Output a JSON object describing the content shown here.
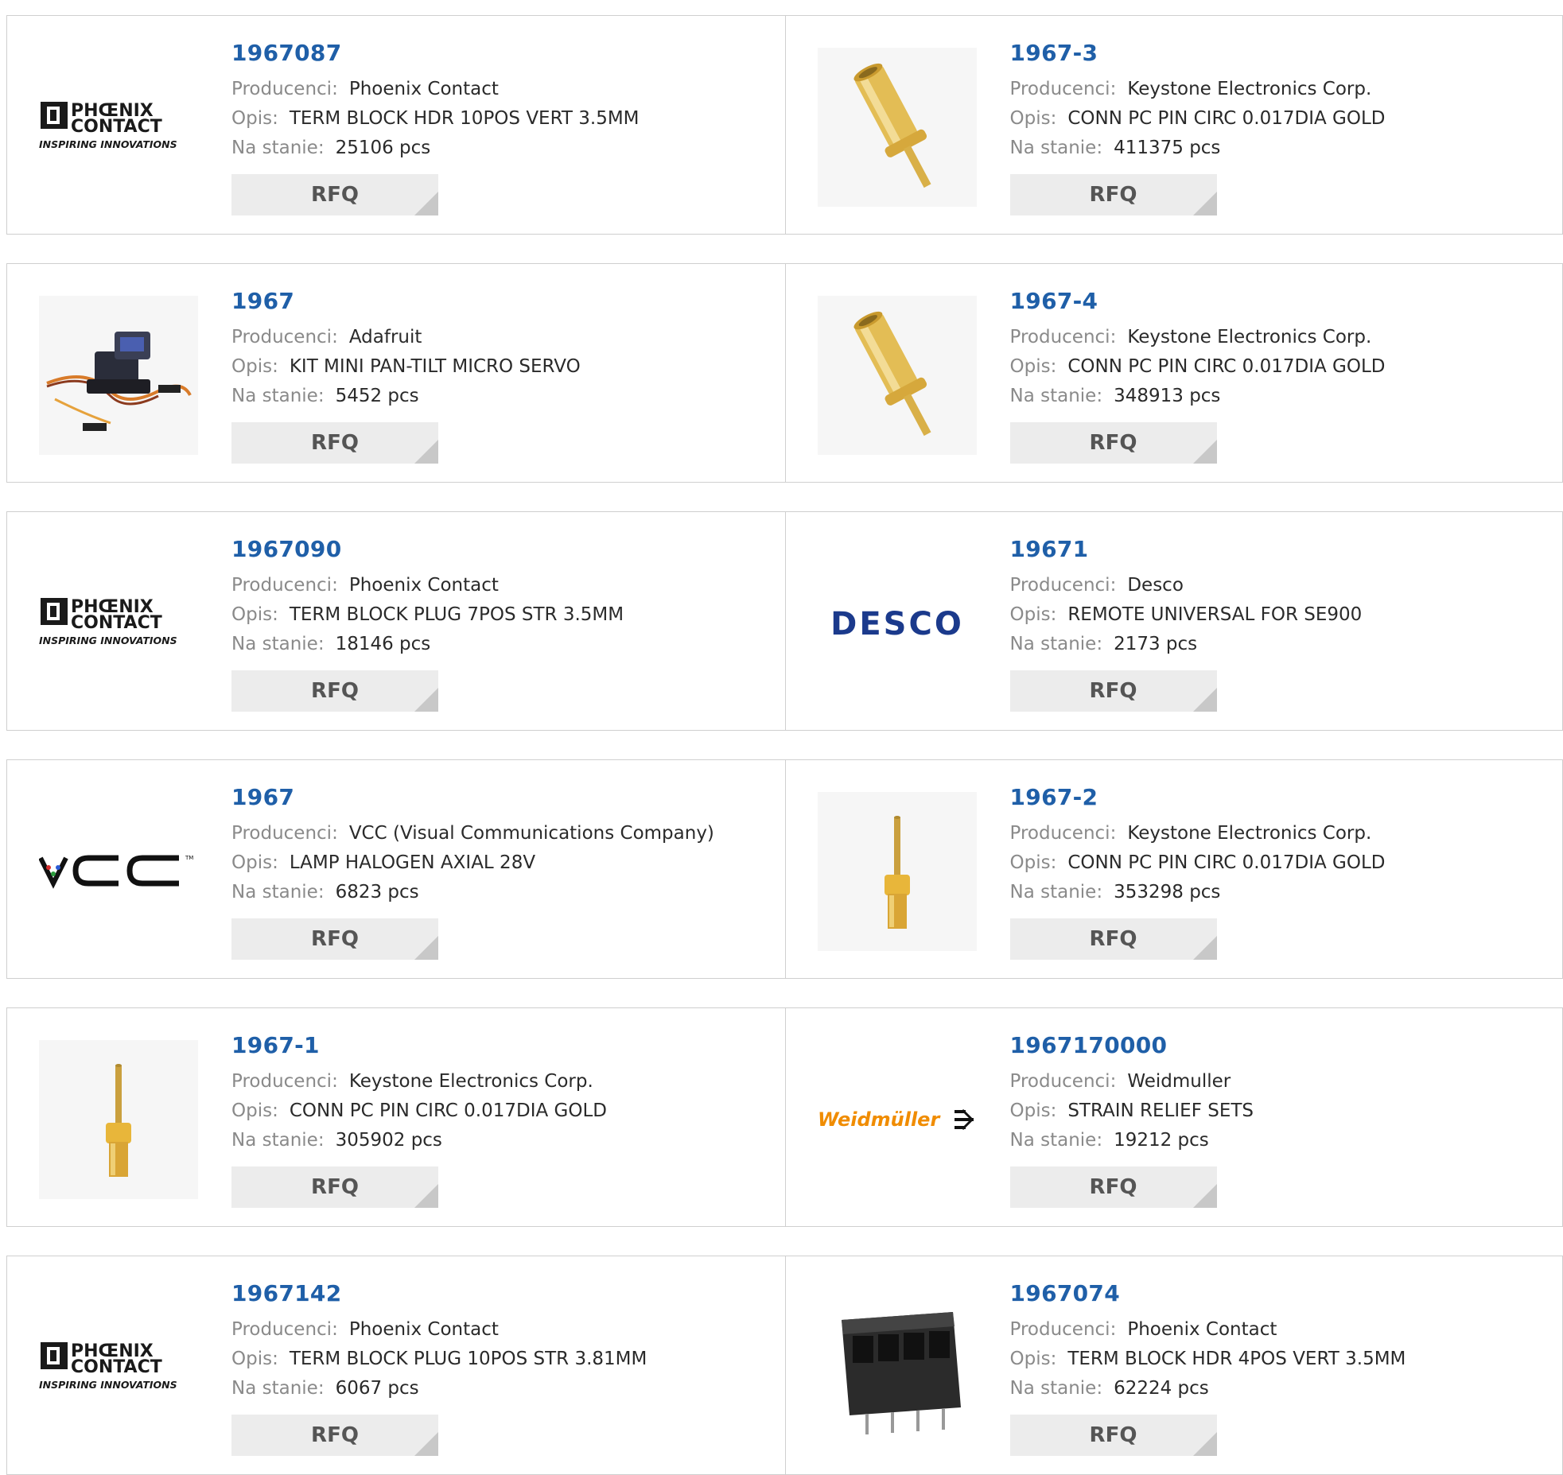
{
  "labels": {
    "manufacturer": "Producenci:",
    "description": "Opis:",
    "stock": "Na stanie:",
    "rfq": "RFQ"
  },
  "logos": {
    "phoenix_line1": "PHŒNIX",
    "phoenix_line2": "CONTACT",
    "phoenix_tagline": "INSPIRING INNOVATIONS",
    "desco": "DESCO",
    "vcc": "VCC",
    "vcc_tm": "TM",
    "weidmuller": "Weidmüller"
  },
  "colors": {
    "part_number": "#1f5fa8",
    "desco": "#1b3a8c",
    "weidmuller": "#f08c00",
    "gold": "#e1b84a"
  },
  "products": [
    {
      "part": "1967087",
      "manufacturer": "Phoenix Contact",
      "description": "TERM BLOCK HDR 10POS VERT 3.5MM",
      "stock": "25106 pcs",
      "image": "phoenix-logo"
    },
    {
      "part": "1967-3",
      "manufacturer": "Keystone Electronics Corp.",
      "description": "CONN PC PIN CIRC 0.017DIA GOLD",
      "stock": "411375 pcs",
      "image": "gold-pin-large"
    },
    {
      "part": "1967",
      "manufacturer": "Adafruit",
      "description": "KIT MINI PAN-TILT MICRO SERVO",
      "stock": "5452 pcs",
      "image": "servo-kit"
    },
    {
      "part": "1967-4",
      "manufacturer": "Keystone Electronics Corp.",
      "description": "CONN PC PIN CIRC 0.017DIA GOLD",
      "stock": "348913 pcs",
      "image": "gold-pin-large"
    },
    {
      "part": "1967090",
      "manufacturer": "Phoenix Contact",
      "description": "TERM BLOCK PLUG 7POS STR 3.5MM",
      "stock": "18146 pcs",
      "image": "phoenix-logo"
    },
    {
      "part": "19671",
      "manufacturer": "Desco",
      "description": "REMOTE UNIVERSAL FOR SE900",
      "stock": "2173 pcs",
      "image": "desco-logo"
    },
    {
      "part": "1967",
      "manufacturer": "VCC (Visual Communications Company)",
      "description": "LAMP HALOGEN AXIAL 28V",
      "stock": "6823 pcs",
      "image": "vcc-logo"
    },
    {
      "part": "1967-2",
      "manufacturer": "Keystone Electronics Corp.",
      "description": "CONN PC PIN CIRC 0.017DIA GOLD",
      "stock": "353298 pcs",
      "image": "gold-pin-small"
    },
    {
      "part": "1967-1",
      "manufacturer": "Keystone Electronics Corp.",
      "description": "CONN PC PIN CIRC 0.017DIA GOLD",
      "stock": "305902 pcs",
      "image": "gold-pin-small"
    },
    {
      "part": "1967170000",
      "manufacturer": "Weidmuller",
      "description": "STRAIN RELIEF SETS",
      "stock": "19212 pcs",
      "image": "weidmuller-logo"
    },
    {
      "part": "1967142",
      "manufacturer": "Phoenix Contact",
      "description": "TERM BLOCK PLUG 10POS STR 3.81MM",
      "stock": "6067 pcs",
      "image": "phoenix-logo"
    },
    {
      "part": "1967074",
      "manufacturer": "Phoenix Contact",
      "description": "TERM BLOCK HDR 4POS VERT 3.5MM",
      "stock": "62224 pcs",
      "image": "terminal-header"
    }
  ]
}
